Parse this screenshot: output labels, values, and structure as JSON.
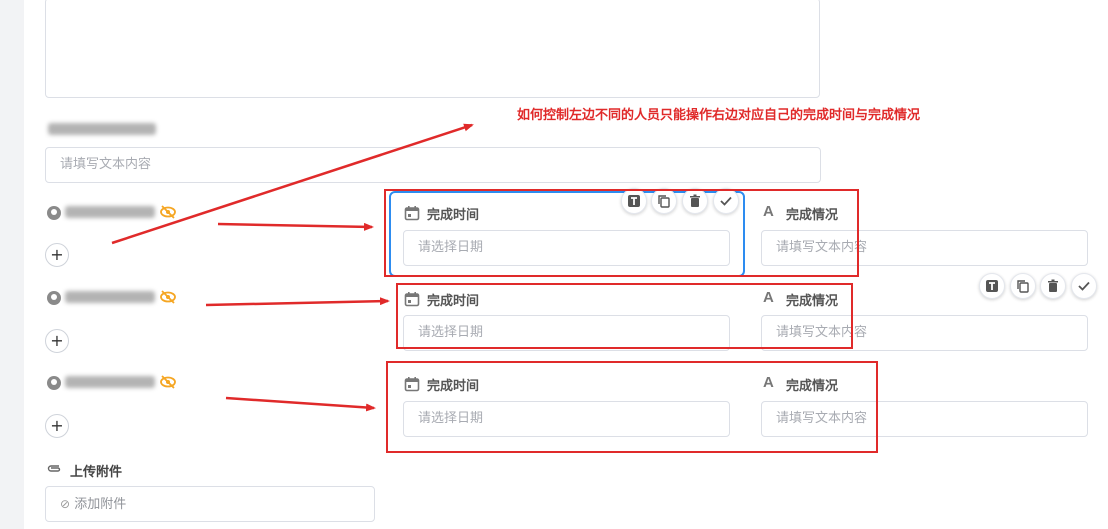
{
  "form": {
    "placeholder_text": "请填写文本内容",
    "placeholder_date": "请选择日期",
    "add_symbol": "+"
  },
  "rows": [
    {
      "time_label": "完成时间",
      "status_label": "完成情况",
      "date_placeholder": "请选择日期",
      "text_placeholder": "请填写文本内容"
    },
    {
      "time_label": "完成时间",
      "status_label": "完成情况",
      "date_placeholder": "请选择日期",
      "text_placeholder": "请填写文本内容"
    },
    {
      "time_label": "完成时间",
      "status_label": "完成情况",
      "date_placeholder": "请选择日期",
      "text_placeholder": "请填写文本内容"
    }
  ],
  "attachment": {
    "label": "上传附件",
    "button": "添加附件"
  },
  "annotation": "如何控制左边不同的人员只能操作右边对应自己的完成时间与完成情况",
  "toolbar_icons": [
    "text-icon",
    "copy-icon",
    "trash-icon",
    "check-icon"
  ],
  "colors": {
    "annotation_red": "#e02a2a",
    "selection_blue": "#2d8cf0",
    "eye_orange": "#f5a623"
  }
}
